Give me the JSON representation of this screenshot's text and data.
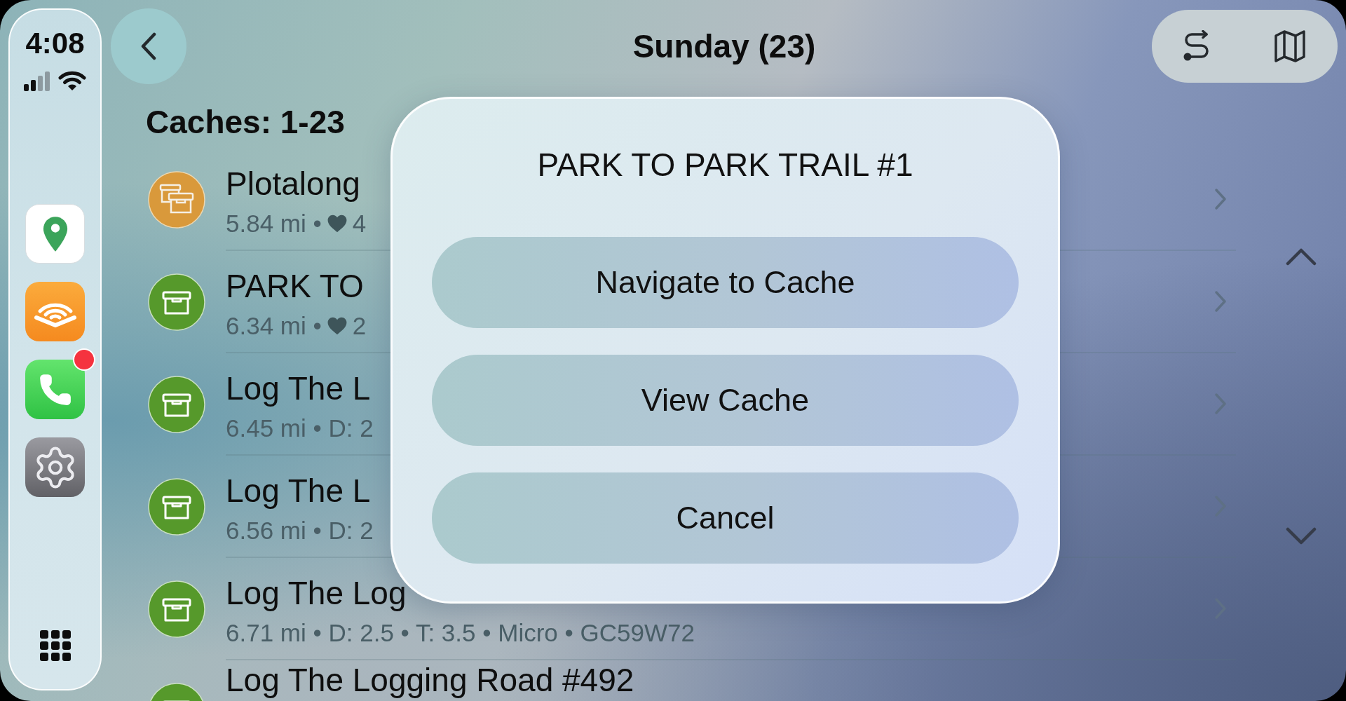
{
  "dock": {
    "time": "4:08",
    "apps": [
      {
        "kind": "pin",
        "badge": false
      },
      {
        "kind": "audio",
        "badge": false
      },
      {
        "kind": "phone",
        "badge": true
      },
      {
        "kind": "gear",
        "badge": false
      }
    ]
  },
  "header": {
    "title": "Sunday (23)"
  },
  "list": {
    "heading": "Caches: 1-23",
    "rows": [
      {
        "kind": "multi",
        "title": "Plotalong",
        "details": "5.84 mi •",
        "favorites": "4"
      },
      {
        "kind": "traditional",
        "title": "PARK TO",
        "details": "6.34 mi •",
        "favorites": "2"
      },
      {
        "kind": "traditional",
        "title": "Log The L",
        "details": "6.45 mi • D: 2"
      },
      {
        "kind": "traditional",
        "title": "Log The L",
        "details": "6.56 mi • D: 2"
      },
      {
        "kind": "traditional",
        "title": "Log The Log",
        "details": "6.71 mi • D: 2.5 • T: 3.5 • Micro • GC59W72"
      },
      {
        "kind": "traditional",
        "title": "Log The Logging Road #492"
      }
    ]
  },
  "dialog": {
    "title": "PARK TO PARK TRAIL #1",
    "buttons": [
      "Navigate to Cache",
      "View Cache",
      "Cancel"
    ]
  }
}
